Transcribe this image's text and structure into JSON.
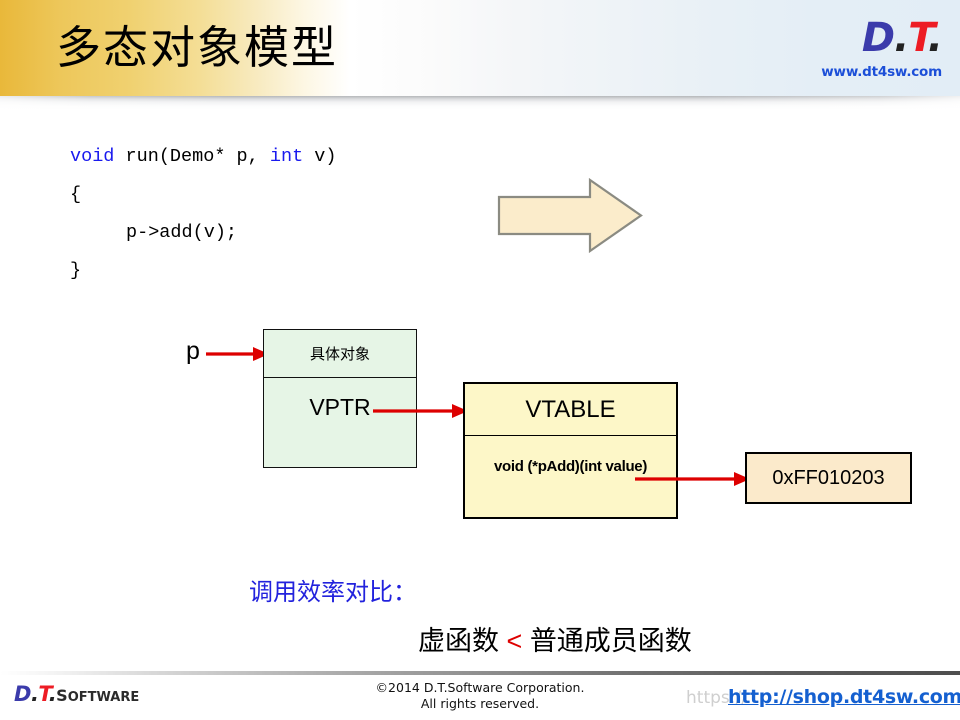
{
  "slide": {
    "title": "多态对象模型"
  },
  "header": {
    "logo": {
      "d": "D",
      "dot1": ".",
      "t": "T",
      "dot2": ".",
      "url": "www.dt4sw.com"
    }
  },
  "code": {
    "line1_kw1": "void",
    "line1_rest": " run(Demo* p, ",
    "line1_kw2": "int",
    "line1_tail": " v)",
    "line2": "{",
    "line3": "p->add(v);",
    "line4": "}"
  },
  "diagram": {
    "pointer_label": "p",
    "object_box": {
      "header": "具体对象",
      "vptr": "VPTR"
    },
    "vtable_box": {
      "header": "VTABLE",
      "entry": "void (*pAdd)(int value)"
    },
    "address_box": {
      "value": "0xFF010203"
    }
  },
  "conclusion": {
    "label": "调用效率对比：",
    "left_term": "虚函数",
    "operator": "<",
    "right_term": "普通成员函数"
  },
  "footer": {
    "logo": {
      "d": "D",
      "dot1": ".",
      "t": "T",
      "dot2": ".",
      "word_s": "S",
      "word_rest": "OFTWARE"
    },
    "copyright_line1": "©2014 D.T.Software Corporation.",
    "copyright_line2": "All rights reserved.",
    "watermark": "https://",
    "link": "http://shop.dt4sw.com"
  },
  "colors": {
    "banner_gold": "#e9b83a",
    "keyword_blue": "#1a1aee",
    "object_fill": "#e6f5e6",
    "vtable_fill": "#fdf7c8",
    "address_fill": "#fbeacb",
    "arrow_red": "#dd0000",
    "conclusion_blue": "#2222dd",
    "link_blue": "#1560d0",
    "logo_d_blue": "#3b3bab",
    "logo_t_red": "#ed1c24"
  }
}
